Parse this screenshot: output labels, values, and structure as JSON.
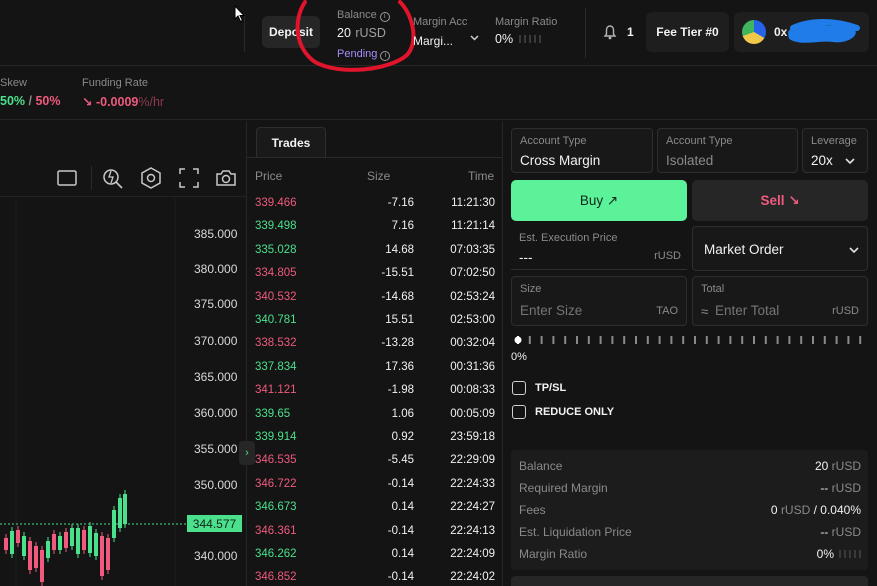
{
  "header": {
    "deposit_label": "Deposit",
    "balance_label": "Balance",
    "balance_value": "20",
    "balance_unit": "rUSD",
    "pending_label": "Pending",
    "margin_acc_label": "Margin Acc",
    "margin_acc_value": "Margi...",
    "margin_ratio_label": "Margin Ratio",
    "margin_ratio_value": "0%",
    "notification_count": "1",
    "fee_tier_label": "Fee Tier #0",
    "wallet_address": "0x"
  },
  "subheader": {
    "skew_label": "Skew",
    "skew_long": "50%",
    "skew_sep": " / ",
    "skew_short": "50%",
    "funding_label": "Funding Rate",
    "funding_arrow": "↘",
    "funding_value": "-0.0009",
    "funding_unit": "%/hr"
  },
  "chart": {
    "y_ticks": [
      "385.000",
      "380.000",
      "375.000",
      "370.000",
      "365.000",
      "360.000",
      "355.000",
      "350.000",
      "340.000"
    ],
    "current_price": "344.577"
  },
  "trades": {
    "tab_label": "Trades",
    "col_price": "Price",
    "col_size": "Size",
    "col_time": "Time",
    "rows": [
      {
        "price": "339.466",
        "size": "-7.16",
        "time": "11:21:30",
        "side": "sell"
      },
      {
        "price": "339.498",
        "size": "7.16",
        "time": "11:21:14",
        "side": "buy"
      },
      {
        "price": "335.028",
        "size": "14.68",
        "time": "07:03:35",
        "side": "buy"
      },
      {
        "price": "334.805",
        "size": "-15.51",
        "time": "07:02:50",
        "side": "sell"
      },
      {
        "price": "340.532",
        "size": "-14.68",
        "time": "02:53:24",
        "side": "sell"
      },
      {
        "price": "340.781",
        "size": "15.51",
        "time": "02:53:00",
        "side": "buy"
      },
      {
        "price": "338.532",
        "size": "-13.28",
        "time": "00:32:04",
        "side": "sell"
      },
      {
        "price": "337.834",
        "size": "17.36",
        "time": "00:31:36",
        "side": "buy"
      },
      {
        "price": "341.121",
        "size": "-1.98",
        "time": "00:08:33",
        "side": "sell"
      },
      {
        "price": "339.65",
        "size": "1.06",
        "time": "00:05:09",
        "side": "buy"
      },
      {
        "price": "339.914",
        "size": "0.92",
        "time": "23:59:18",
        "side": "buy"
      },
      {
        "price": "346.535",
        "size": "-5.45",
        "time": "22:29:09",
        "side": "sell"
      },
      {
        "price": "346.722",
        "size": "-0.14",
        "time": "22:24:33",
        "side": "sell"
      },
      {
        "price": "346.673",
        "size": "0.14",
        "time": "22:24:27",
        "side": "buy"
      },
      {
        "price": "346.361",
        "size": "-0.14",
        "time": "22:24:13",
        "side": "sell"
      },
      {
        "price": "346.262",
        "size": "0.14",
        "time": "22:24:09",
        "side": "buy"
      },
      {
        "price": "346.852",
        "size": "-0.14",
        "time": "22:24:02",
        "side": "sell"
      }
    ]
  },
  "order": {
    "account_type_label": "Account Type",
    "cross_margin": "Cross Margin",
    "isolated": "Isolated",
    "leverage_label": "Leverage",
    "leverage_value": "20x",
    "buy_label": "Buy ↗",
    "sell_label": "Sell ↘",
    "est_exec_label": "Est. Execution Price",
    "est_exec_value": "---",
    "est_exec_unit": "rUSD",
    "order_type": "Market Order",
    "size_label": "Size",
    "size_placeholder": "Enter Size",
    "size_unit": "TAO",
    "total_label": "Total",
    "total_prefix": "≈",
    "total_placeholder": "Enter Total",
    "total_unit": "rUSD",
    "slider_value": "0%",
    "tpsl_label": "TP/SL",
    "reduce_only_label": "REDUCE ONLY"
  },
  "summary": {
    "balance_label": "Balance",
    "balance_value": "20",
    "balance_unit": "rUSD",
    "req_margin_label": "Required Margin",
    "req_margin_value": "--",
    "req_margin_unit": "rUSD",
    "fees_label": "Fees",
    "fees_value": "0",
    "fees_unit": "rUSD",
    "fees_sep": " / ",
    "fees_pct": "0.040%",
    "liq_label": "Est. Liquidation Price",
    "liq_value": "--",
    "liq_unit": "rUSD",
    "margin_ratio_label": "Margin Ratio",
    "margin_ratio_value": "0%"
  },
  "colors": {
    "accent_green": "#4ae08c",
    "buy_button": "#5cf29a",
    "sell_red": "#ef5a7e",
    "pending_purple": "#a78bfa"
  }
}
